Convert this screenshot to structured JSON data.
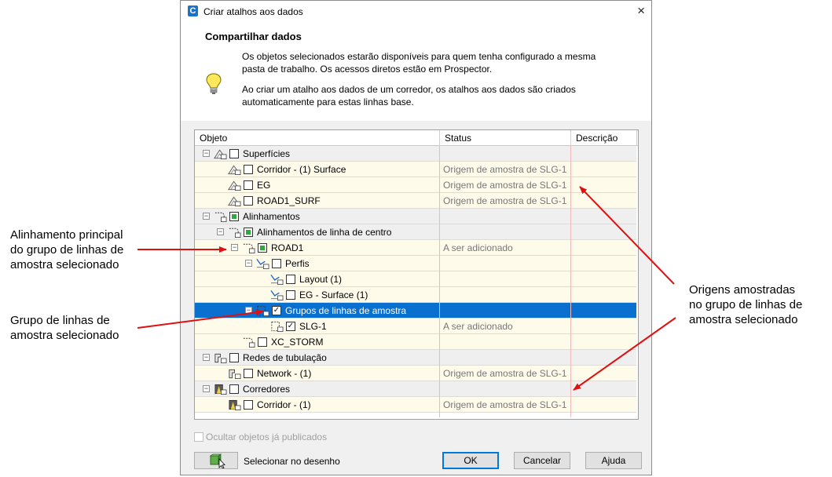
{
  "window": {
    "title": "Criar atalhos aos dados",
    "app_icon": "C",
    "close": "×"
  },
  "header": {
    "title": "Compartilhar dados",
    "para1_l1": "Os objetos selecionados estarão disponíveis para quem tenha configurado a mesma",
    "para1_l2": "pasta de trabalho. Os acessos diretos estão em Prospector.",
    "para2_l1": "Ao criar um atalho aos dados de um corredor, os atalhos aos dados são criados",
    "para2_l2": "automaticamente para estas linhas base."
  },
  "columns": {
    "objeto": "Objeto",
    "status": "Status",
    "descricao": "Descrição"
  },
  "rows": [
    {
      "label": "Superfícies",
      "status": ""
    },
    {
      "label": "Corridor - (1) Surface",
      "status": "Origem de amostra de SLG-1"
    },
    {
      "label": "EG",
      "status": "Origem de amostra de SLG-1"
    },
    {
      "label": "ROAD1_SURF",
      "status": "Origem de amostra de SLG-1"
    },
    {
      "label": "Alinhamentos",
      "status": ""
    },
    {
      "label": "Alinhamentos de linha de centro",
      "status": ""
    },
    {
      "label": "ROAD1",
      "status": "A ser adicionado"
    },
    {
      "label": "Perfis",
      "status": ""
    },
    {
      "label": "Layout (1)",
      "status": ""
    },
    {
      "label": "EG - Surface (1)",
      "status": ""
    },
    {
      "label": "Grupos de linhas de amostra",
      "status": ""
    },
    {
      "label": "SLG-1",
      "status": "A ser adicionado"
    },
    {
      "label": "XC_STORM",
      "status": ""
    },
    {
      "label": "Redes de tubulação",
      "status": ""
    },
    {
      "label": "Network - (1)",
      "status": "Origem de amostra de SLG-1"
    },
    {
      "label": "Corredores",
      "status": ""
    },
    {
      "label": "Corridor - (1)",
      "status": "Origem de amostra de SLG-1"
    }
  ],
  "options": {
    "hide_published": "Ocultar objetos já publicados"
  },
  "buttons": {
    "select_in_drawing": "Selecionar no desenho",
    "ok": "OK",
    "cancel": "Cancelar",
    "help": "Ajuda"
  },
  "annotations": {
    "main_alignment_l1": "Alinhamento principal",
    "main_alignment_l2": "do grupo de linhas de",
    "main_alignment_l3": "amostra selecionado",
    "slg_l1": "Grupo de linhas de",
    "slg_l2": "amostra selecionado",
    "sources_l1": "Origens amostradas",
    "sources_l2": "no grupo de linhas de",
    "sources_l3": "amostra selecionado"
  },
  "colors": {
    "selection": "#0a70cf",
    "annotation_arrow": "#e01010",
    "partial_check": "#2faa3a"
  }
}
